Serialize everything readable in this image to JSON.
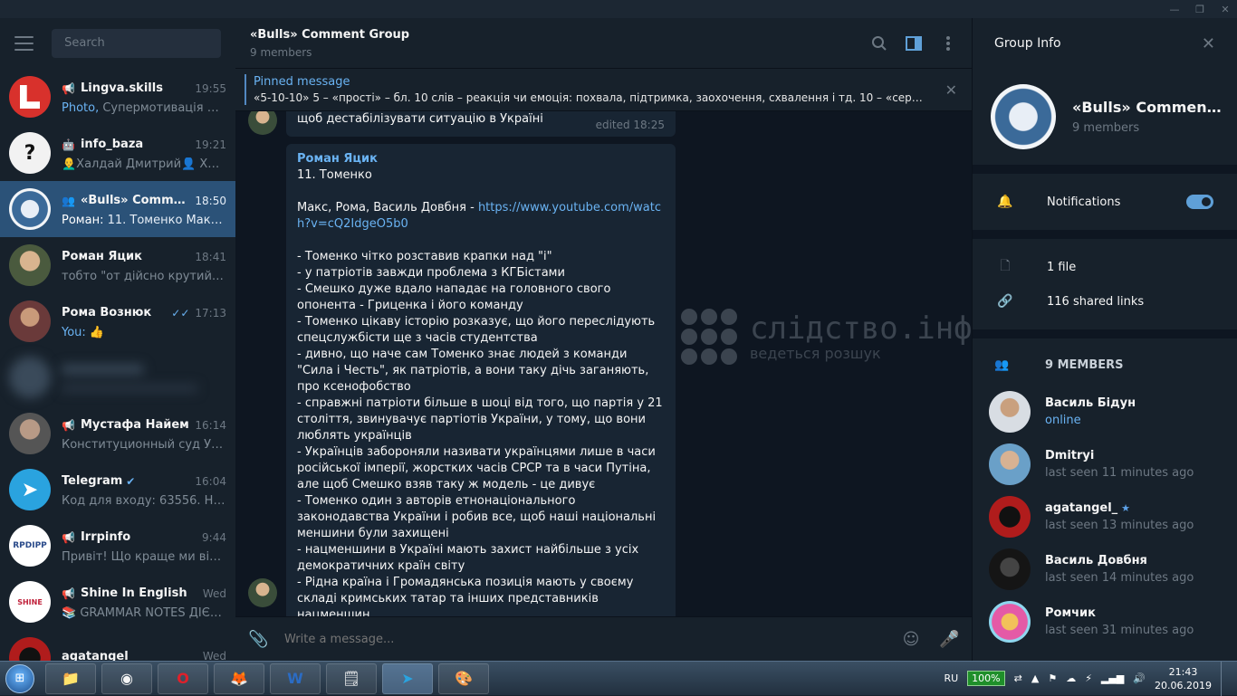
{
  "sidebar": {
    "search_placeholder": "Search",
    "chats": [
      {
        "name": "Lingva.skills",
        "time": "19:55",
        "preview_hl": "Photo,",
        "preview": " Супермотивація на в...",
        "type": "channel"
      },
      {
        "name": "info_baza",
        "time": "19:21",
        "preview_hl": "",
        "preview": "👨‍🦲Халдай Дмитрий👤 Хал...",
        "type": "channel"
      },
      {
        "name": "«Bulls» Comment ...",
        "time": "18:50",
        "preview_hl": "Роман:",
        "preview": " 11. Томенко  Макс, ...",
        "type": "group"
      },
      {
        "name": "Роман Яцик",
        "time": "18:41",
        "preview_hl": "",
        "preview": "тобто \"от дійсно крутий ре...",
        "type": "user"
      },
      {
        "name": "Рома Вознюк",
        "time": "17:13",
        "preview_hl": "You:",
        "preview": " 👍",
        "type": "user"
      },
      {
        "name": "Мустафа Найем",
        "time": "16:14",
        "preview_hl": "",
        "preview": "Конституционный суд Укра...",
        "type": "channel"
      },
      {
        "name": "Telegram",
        "time": "16:04",
        "preview_hl": "",
        "preview": "Код для входу: 63556. Не по...",
        "type": "user"
      },
      {
        "name": "Irrpinfo",
        "time": "9:44",
        "preview_hl": "",
        "preview": "Привіт!  Що краще ми візуа...",
        "type": "channel"
      },
      {
        "name": "Shine In English",
        "time": "Wed",
        "preview_hl": "",
        "preview": "📚 GRAMMAR NOTES ДІЄСЛ...",
        "type": "channel"
      },
      {
        "name": "agatangel_",
        "time": "Wed",
        "preview_hl": "",
        "preview": "",
        "type": "user"
      }
    ]
  },
  "chat": {
    "title": "«Bulls» Comment Group",
    "members": "9 members",
    "pinned_title": "Pinned message",
    "pinned_text": "«5-10-10»  5 – «прості» – бл. 10 слів – реакція чи емоція: похвала, підтримка, заохочення, схвалення і тд. 10 – «середні» ...",
    "msg1_text": "щоб дестабілізувати ситуацію в Україні",
    "msg1_edited": "edited 18:25",
    "msg2_sender": "Роман Яцик",
    "msg2_head": "11. Томенко",
    "msg2_line2": "Макс, Рома, Василь Довбня - ",
    "msg2_link": "https://www.youtube.com/watch?v=cQ2IdgeO5b0",
    "msg2_body": "- Томенко чітко розставив крапки над \"і\"\n- у патріотів завжди проблема з КГБістами\n- Смешко дуже вдало нападає на головного свого опонента - Гриценка і його команду\n- Томенко цікаву історію розказує, що його переслідують спецслужбісти ще з часів студентства\n- дивно, що наче сам Томенко знає людей з команди \"Сила і Честь\", як патріотів, а вони таку дічь заганяють, про ксенофобство\n- справжні патріоти більше в шоці від того, що партія у 21 століття, звинувачує партіотів України, у тому, що вони люблять українців\n- Українців забороняли називати українцями лише в часи російської імперії, жорстких часів СРСР та в часи Путіна, але щоб Смешко взяв таку ж модель - це дивує\n- Томенко один з авторів етнонаціонального законодавства України і робив все, щоб наші національні меншини були захищені\n- нацменшини в Україні мають захист найбільше з усіх демократичних країн світу\n- Рідна країна і Громадянська позиція мають у своєму складі кримських татар та інших представників нацменшин\n- правильно, бо національні меншини мають також шанувати",
    "watermark_title": "слідство.інфо",
    "watermark_sub": "ведеться розшук",
    "composer_placeholder": "Write a message..."
  },
  "info": {
    "title": "Group Info",
    "group_name": "«Bulls» Comment G...",
    "group_members": "9 members",
    "notifications": "Notifications",
    "files": "1 file",
    "links": "116 shared links",
    "members_header": "9 MEMBERS",
    "members": [
      {
        "name": "Василь Бідун",
        "status": "online"
      },
      {
        "name": "Dmitryi",
        "status": "last seen 11 minutes ago"
      },
      {
        "name": "agatangel_",
        "status": "last seen 13 minutes ago"
      },
      {
        "name": "Василь Довбня",
        "status": "last seen 14 minutes ago"
      },
      {
        "name": "Ромчик",
        "status": "last seen 31 minutes ago"
      }
    ]
  },
  "taskbar": {
    "lang": "RU",
    "battery": "100%",
    "time": "21:43",
    "date": "20.06.2019"
  },
  "colors": {
    "accent": "#5288c1",
    "active_chat": "#2b5278",
    "background": "#0e1621",
    "panel": "#17212b"
  }
}
